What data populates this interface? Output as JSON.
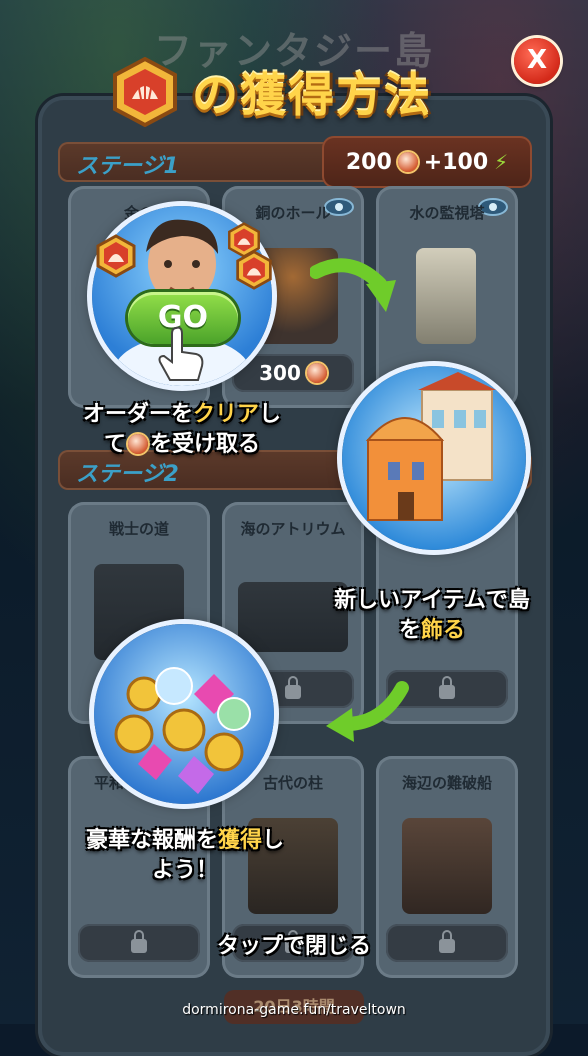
{
  "background_title": "ファンタジー島",
  "headline": {
    "title": "の獲得方法"
  },
  "close_button": {
    "label": "X"
  },
  "stage1": {
    "label": "ステージ1",
    "reward_shells": "200",
    "reward_energy": "+100",
    "cards": [
      {
        "title": "金の",
        "button": ""
      },
      {
        "title": "銅のホール",
        "button": "300"
      },
      {
        "title": "水の監視塔",
        "button": ""
      }
    ]
  },
  "stage2": {
    "label": "ステージ2",
    "cards": [
      {
        "title": "戦士の道"
      },
      {
        "title": "海のアトリウム"
      },
      {
        "title": ""
      }
    ]
  },
  "stage3_cards": [
    {
      "title": "平和のテンテ"
    },
    {
      "title": "古代の柱"
    },
    {
      "title": "海辺の難破船"
    }
  ],
  "go_button": "GO",
  "steps": {
    "step1_pre": "オーダーを",
    "step1_highlight": "クリア",
    "step1_mid": "し",
    "step1_line2_a": "て",
    "step1_line2_b": "を受け取る",
    "step2_line1": "新しいアイテムで島",
    "step2_line2_a": "を",
    "step2_highlight": "飾る",
    "step3_line1_a": "豪華な報酬を",
    "step3_highlight": "獲得",
    "step3_line1_b": "し",
    "step3_line2": "よう！"
  },
  "hint": "タップで閉じる",
  "timer_text": "20日3時間",
  "footer_url": "dormirona-game.fun/traveltown",
  "colors": {
    "accent_gold": "#ffd44a",
    "close_red": "#d42a1a",
    "go_green": "#4ba32a"
  }
}
